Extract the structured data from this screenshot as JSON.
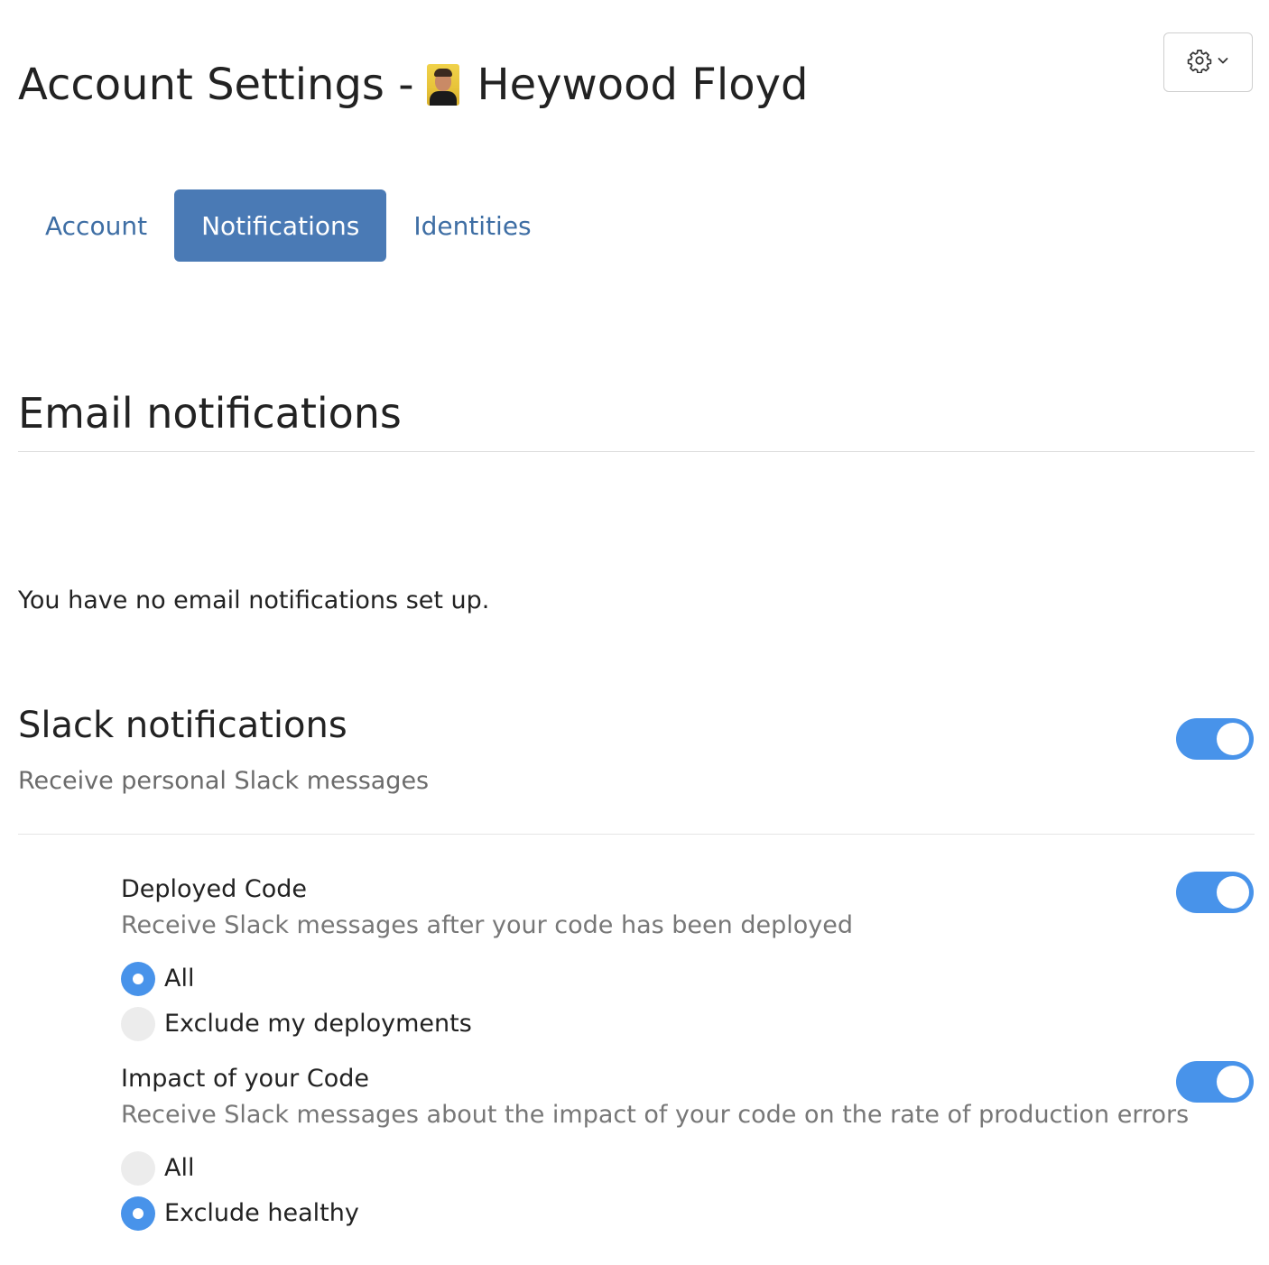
{
  "header": {
    "title_prefix": "Account Settings -",
    "user_name": "Heywood Floyd",
    "settings_icon": "gear-icon",
    "dropdown_icon": "chevron-down-icon"
  },
  "tabs": [
    {
      "label": "Account",
      "active": false
    },
    {
      "label": "Notifications",
      "active": true
    },
    {
      "label": "Identities",
      "active": false
    }
  ],
  "email": {
    "heading": "Email notifications",
    "empty_message": "You have no email notifications set up."
  },
  "slack": {
    "heading": "Slack notifications",
    "subtitle": "Receive personal Slack messages",
    "enabled": true,
    "deployed_code": {
      "title": "Deployed Code",
      "description": "Receive Slack messages after your code has been deployed",
      "enabled": true,
      "options": [
        {
          "label": "All",
          "checked": true
        },
        {
          "label": "Exclude my deployments",
          "checked": false
        }
      ]
    },
    "impact": {
      "title": "Impact of your Code",
      "description": "Receive Slack messages about the impact of your code on the rate of production errors",
      "enabled": true,
      "options": [
        {
          "label": "All",
          "checked": false
        },
        {
          "label": "Exclude healthy",
          "checked": true
        }
      ]
    }
  },
  "colors": {
    "accent": "#4893ea",
    "tab_active_bg": "#4a7ab5",
    "link": "#3e6ea4"
  }
}
